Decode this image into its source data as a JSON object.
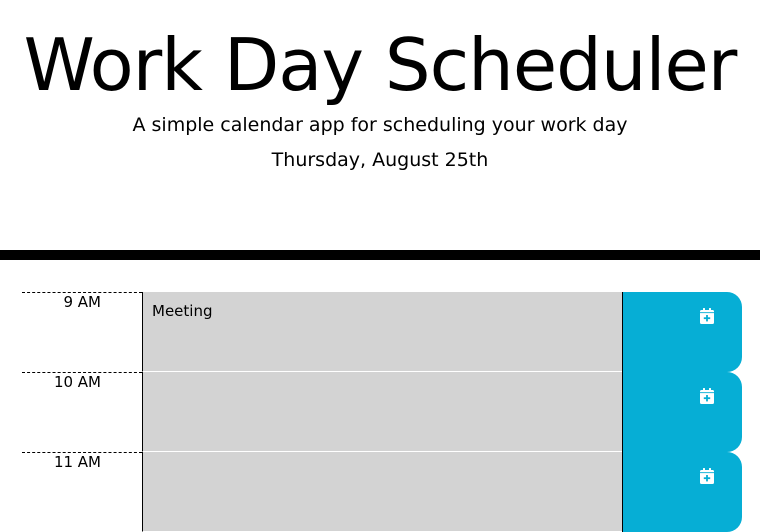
{
  "header": {
    "title": "Work Day Scheduler",
    "subtitle": "A simple calendar app for scheduling your work day",
    "current_day": "Thursday, August 25th"
  },
  "timeblocks": [
    {
      "hour": "9 AM",
      "description": "Meeting",
      "save_icon": "calendar-plus-icon"
    },
    {
      "hour": "10 AM",
      "description": "",
      "save_icon": "calendar-plus-icon"
    },
    {
      "hour": "11 AM",
      "description": "",
      "save_icon": "calendar-plus-icon"
    }
  ],
  "colors": {
    "past": "#d3d3d3",
    "save_button": "#06aed5",
    "divider": "#000000"
  }
}
